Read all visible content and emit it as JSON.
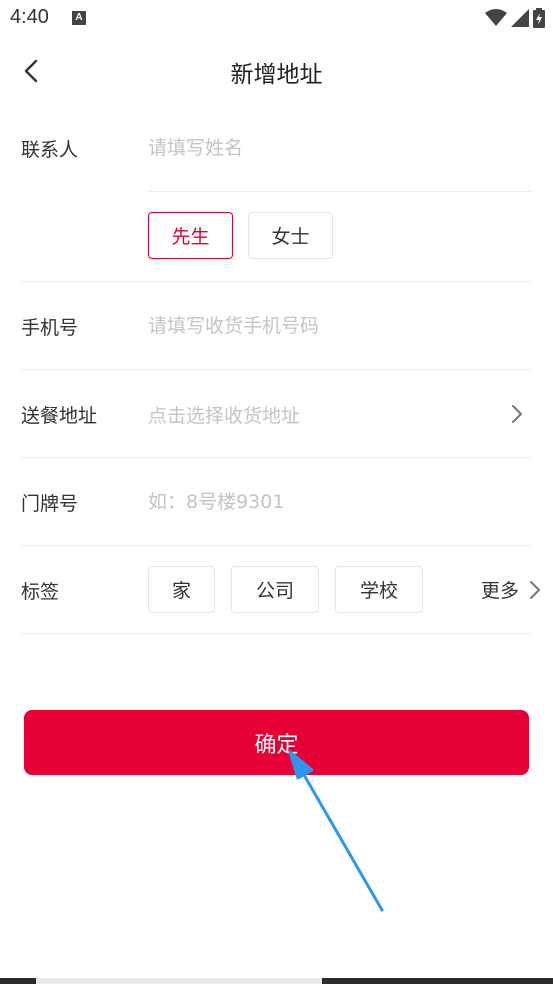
{
  "status_bar": {
    "time": "4:40",
    "notification_letter": "A"
  },
  "nav": {
    "title": "新增地址"
  },
  "form": {
    "contact": {
      "label": "联系人",
      "placeholder": "请填写姓名",
      "value": ""
    },
    "gender": {
      "options": [
        "先生",
        "女士"
      ],
      "selected": "先生"
    },
    "phone": {
      "label": "手机号",
      "placeholder": "请填写收货手机号码",
      "value": ""
    },
    "address": {
      "label": "送餐地址",
      "placeholder": "点击选择收货地址"
    },
    "door": {
      "label": "门牌号",
      "placeholder": "如：8号楼9301",
      "value": ""
    },
    "tags": {
      "label": "标签",
      "options": [
        "家",
        "公司",
        "学校"
      ],
      "more_label": "更多"
    }
  },
  "confirm_button": {
    "label": "确定"
  },
  "colors": {
    "accent": "#e4002b",
    "button": "#e60033",
    "annotation_arrow": "#2f95ef"
  }
}
